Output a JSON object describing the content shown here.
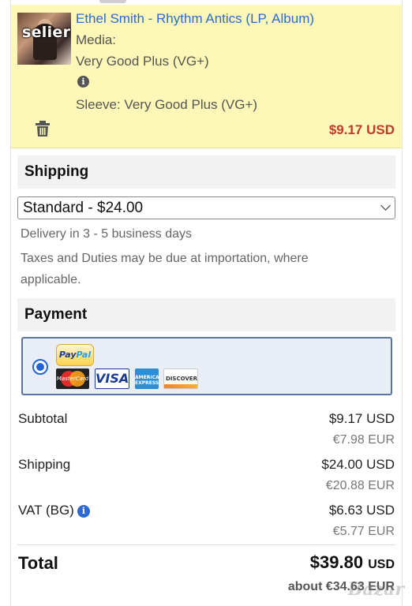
{
  "item": {
    "seller_tag": "selier",
    "title": "Ethel Smith - Rhythm Antics (LP, Album)",
    "media_label": "Media:",
    "media_condition": "Very Good Plus (VG+)",
    "sleeve": "Sleeve: Very Good Plus (VG+)",
    "price": "$9.17 USD",
    "price_color": "#c0392b",
    "title_color": "#2b6bd3",
    "background": "#fdf8b8"
  },
  "shipping": {
    "heading": "Shipping",
    "selected_option": "Standard - $24.00",
    "delivery": "Delivery in 3 - 5 business days",
    "taxes_note_line1": "Taxes and Duties may be due at importation, where",
    "taxes_note_line2": "applicable."
  },
  "payment": {
    "heading": "Payment",
    "method_selected": true,
    "logos": {
      "paypal_1": "Pay",
      "paypal_2": "Pal",
      "mastercard": "MasterCard",
      "visa": "VISA",
      "amex": "AMERICAN EXPRESS",
      "discover": "DISCOVER"
    },
    "border_color": "#56769f",
    "accent": "#2264d6"
  },
  "summary": {
    "subtotal_label": "Subtotal",
    "subtotal_usd": "$9.17",
    "subtotal_eur": "€7.98 EUR",
    "shipping_label": "Shipping",
    "shipping_usd": "$24.00",
    "shipping_eur": "€20.88 EUR",
    "vat_label": "VAT (BG)",
    "vat_usd": "$6.63",
    "vat_eur": "€5.77 EUR",
    "currency": "USD",
    "total_label": "Total",
    "total_usd": "$39.80",
    "total_about": "about €34.63 EUR"
  },
  "watermark": "Bazar"
}
